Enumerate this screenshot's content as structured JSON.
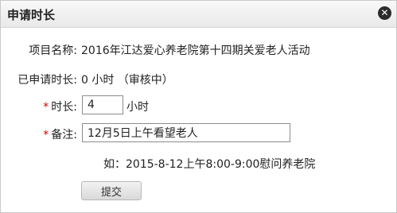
{
  "dialog": {
    "title": "申请时长",
    "close_icon": "close-icon"
  },
  "form": {
    "project_label": "项目名称:",
    "project_value": "2016年江达爱心养老院第十四期关爱老人活动",
    "applied_label": "已申请时长:",
    "applied_value": "0 小时 （审核中）",
    "duration_required": "*",
    "duration_label": "时长:",
    "duration_value": "4",
    "duration_unit": "小时",
    "remark_required": "*",
    "remark_label": "备注:",
    "remark_value": "12月5日上午看望老人",
    "hint": "如：2015-8-12上午8:00-9:00慰问养老院",
    "submit_label": "提交"
  }
}
